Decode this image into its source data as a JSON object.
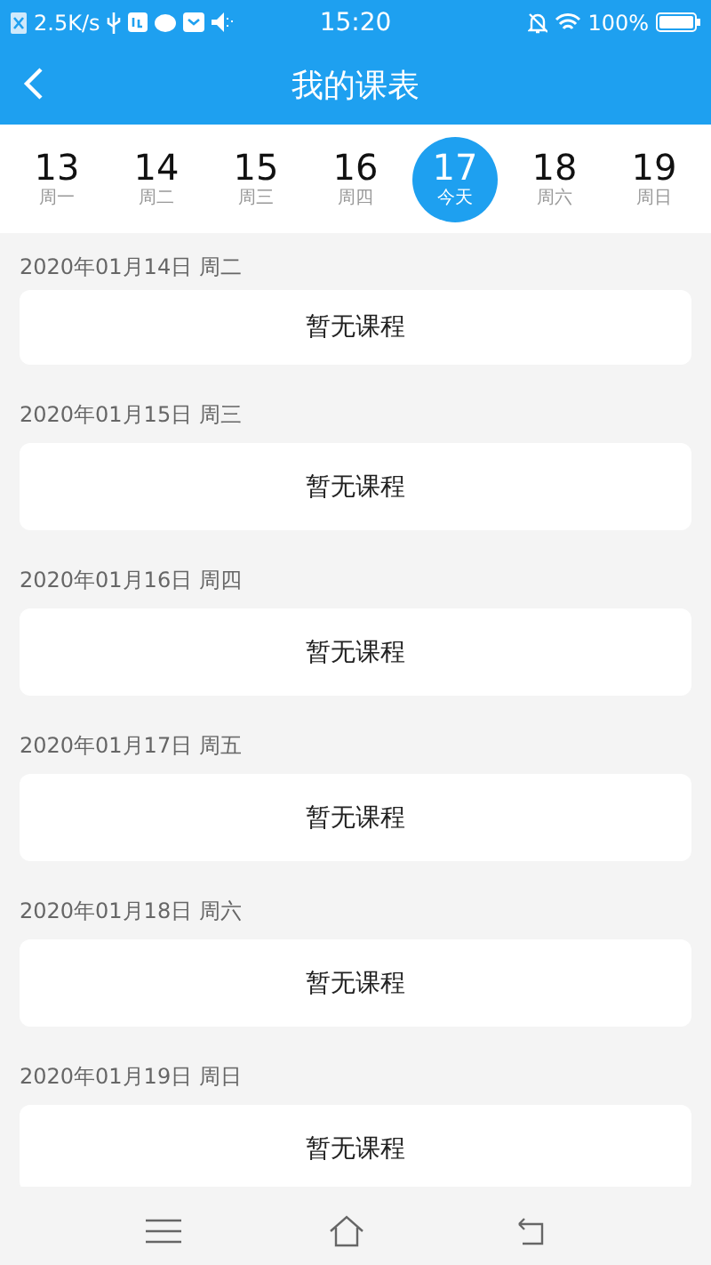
{
  "status_bar": {
    "speed": "2.5K/s",
    "time": "15:20",
    "battery": "100%"
  },
  "header": {
    "title": "我的课表"
  },
  "days": [
    {
      "number": "13",
      "label": "周一",
      "selected": false
    },
    {
      "number": "14",
      "label": "周二",
      "selected": false
    },
    {
      "number": "15",
      "label": "周三",
      "selected": false
    },
    {
      "number": "16",
      "label": "周四",
      "selected": false
    },
    {
      "number": "17",
      "label": "今天",
      "selected": true
    },
    {
      "number": "18",
      "label": "周六",
      "selected": false
    },
    {
      "number": "19",
      "label": "周日",
      "selected": false
    }
  ],
  "sections": [
    {
      "date": "2020年01月14日 周二",
      "message": "暂无课程"
    },
    {
      "date": "2020年01月15日 周三",
      "message": "暂无课程"
    },
    {
      "date": "2020年01月16日 周四",
      "message": "暂无课程"
    },
    {
      "date": "2020年01月17日 周五",
      "message": "暂无课程"
    },
    {
      "date": "2020年01月18日 周六",
      "message": "暂无课程"
    },
    {
      "date": "2020年01月19日 周日",
      "message": "暂无课程"
    }
  ]
}
